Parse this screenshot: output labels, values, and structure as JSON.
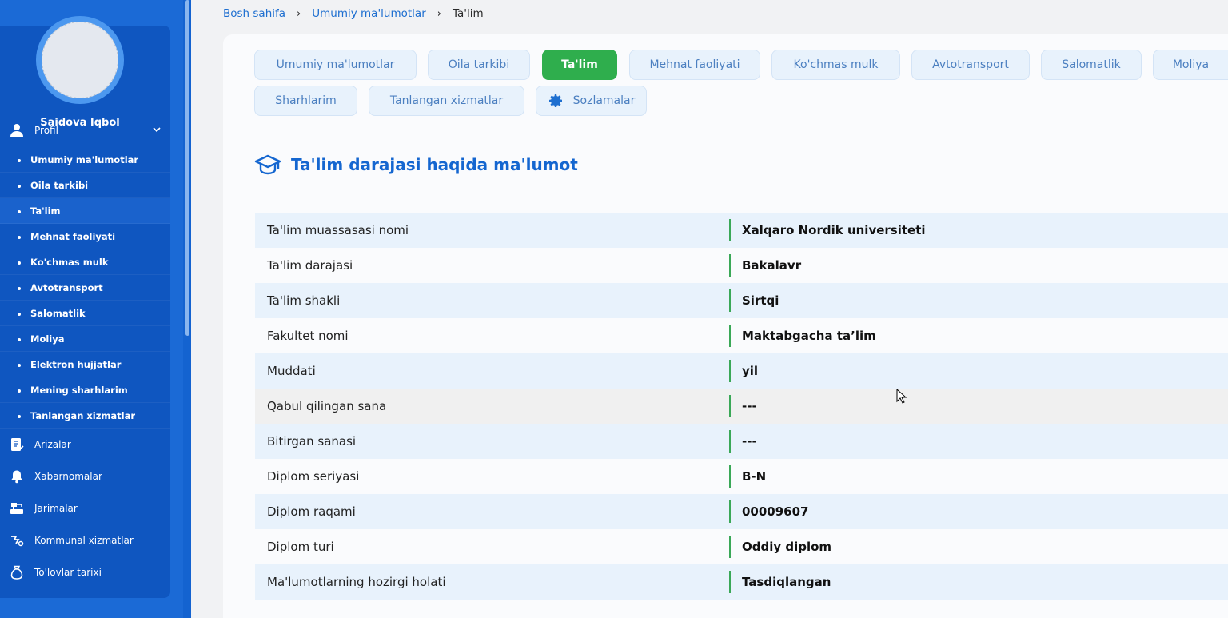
{
  "user": {
    "name": "Saidova Iqbol",
    "avatar_alt": "profile photo"
  },
  "sidebar": {
    "profile": {
      "label": "Profil",
      "icon": "user-icon"
    },
    "sub_items": [
      {
        "label": "Umumiy ma'lumotlar"
      },
      {
        "label": "Oila tarkibi"
      },
      {
        "label": "Ta'lim"
      },
      {
        "label": "Mehnat faoliyati"
      },
      {
        "label": "Ko'chmas mulk"
      },
      {
        "label": "Avtotransport"
      },
      {
        "label": "Salomatlik"
      },
      {
        "label": "Moliya"
      },
      {
        "label": "Elektron hujjatlar"
      },
      {
        "label": "Mening sharhlarim"
      },
      {
        "label": "Tanlangan xizmatlar"
      }
    ],
    "items": [
      {
        "label": "Arizalar",
        "icon": "document-list-icon"
      },
      {
        "label": "Xabarnomalar",
        "icon": "bell-icon"
      },
      {
        "label": "Jarimalar",
        "icon": "fine-icon"
      },
      {
        "label": "Kommunal xizmatlar",
        "icon": "utility-icon"
      },
      {
        "label": "To'lovlar tarixi",
        "icon": "money-bag-icon"
      }
    ]
  },
  "breadcrumb": {
    "home": "Bosh sahifa",
    "parent": "Umumiy ma'lumotlar",
    "current": "Ta'lim"
  },
  "tabs": [
    {
      "label": "Umumiy ma'lumotlar"
    },
    {
      "label": "Oila tarkibi"
    },
    {
      "label": "Ta'lim"
    },
    {
      "label": "Mehnat faoliyati"
    },
    {
      "label": "Ko'chmas mulk"
    },
    {
      "label": "Avtotransport"
    },
    {
      "label": "Salomatlik"
    },
    {
      "label": "Moliya"
    },
    {
      "label": "Sharhlarim"
    },
    {
      "label": "Tanlangan xizmatlar"
    },
    {
      "label": "Sozlamalar"
    }
  ],
  "section": {
    "title": "Ta'lim darajasi haqida ma'lumot"
  },
  "education": [
    {
      "label": "Ta'lim muassasasi nomi",
      "value": "Xalqaro Nordik universiteti"
    },
    {
      "label": "Ta'lim darajasi",
      "value": "Bakalavr"
    },
    {
      "label": "Ta'lim shakli",
      "value": "Sirtqi"
    },
    {
      "label": "Fakultet nomi",
      "value": "Maktabgacha ta’lim"
    },
    {
      "label": "Muddati",
      "value": "yil"
    },
    {
      "label": "Qabul qilingan sana",
      "value": "---"
    },
    {
      "label": "Bitirgan sanasi",
      "value": "---"
    },
    {
      "label": "Diplom seriyasi",
      "value": "B-N"
    },
    {
      "label": "Diplom raqami",
      "value": "00009607"
    },
    {
      "label": "Diplom turi",
      "value": "Oddiy diplom"
    },
    {
      "label": "Ma'lumotlarning hozirgi holati",
      "value": "Tasdiqlangan"
    }
  ],
  "colors": {
    "sidebar": "#1b6ad6",
    "sidebar_panel": "#0f56c0",
    "accent": "#1466d0",
    "active_tab": "#2fae4d",
    "divider": "#3aa857"
  }
}
